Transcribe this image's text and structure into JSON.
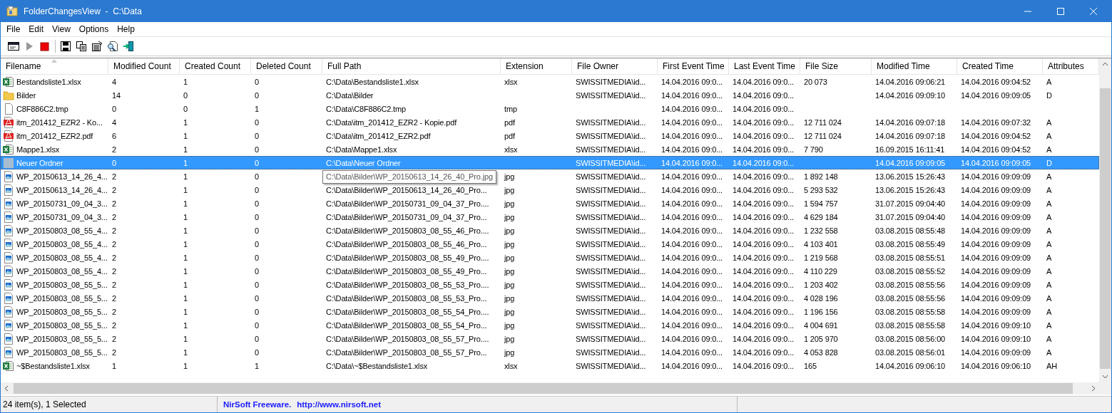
{
  "window": {
    "title": "FolderChangesView  -  C:\\Data"
  },
  "menu": [
    "File",
    "Edit",
    "View",
    "Options",
    "Help"
  ],
  "columns": [
    {
      "label": "Filename",
      "sorted": true
    },
    {
      "label": "Modified Count",
      "sorted": false
    },
    {
      "label": "Created Count",
      "sorted": false
    },
    {
      "label": "Deleted Count",
      "sorted": false
    },
    {
      "label": "Full Path",
      "sorted": false
    },
    {
      "label": "Extension",
      "sorted": false
    },
    {
      "label": "File Owner",
      "sorted": false
    },
    {
      "label": "First Event Time",
      "sorted": false
    },
    {
      "label": "Last Event Time",
      "sorted": false
    },
    {
      "label": "File Size",
      "sorted": false
    },
    {
      "label": "Modified Time",
      "sorted": false
    },
    {
      "label": "Created Time",
      "sorted": false
    },
    {
      "label": "Attributes",
      "sorted": false
    }
  ],
  "rows": [
    {
      "kind": "excel",
      "selected": false,
      "filename": "Bestandsliste1.xlsx",
      "modified_count": "4",
      "created_count": "1",
      "deleted_count": "0",
      "full_path": "C:\\Data\\Bestandsliste1.xlsx",
      "extension": "xlsx",
      "file_owner": "SWISSITMEDIA\\id...",
      "first_event_time": "14.04.2016 09:0...",
      "last_event_time": "14.04.2016 09:0...",
      "file_size": "20 073",
      "modified_time": "14.04.2016 09:06:21",
      "created_time": "14.04.2016 09:04:52",
      "attributes": "A"
    },
    {
      "kind": "folder",
      "selected": false,
      "filename": "Bilder",
      "modified_count": "14",
      "created_count": "0",
      "deleted_count": "0",
      "full_path": "C:\\Data\\Bilder",
      "file_owner": "SWISSITMEDIA\\id...",
      "first_event_time": "14.04.2016 09:0...",
      "last_event_time": "14.04.2016 09:0...",
      "modified_time": "14.04.2016 09:09:10",
      "created_time": "14.04.2016 09:09:05",
      "attributes": "D"
    },
    {
      "kind": "file",
      "selected": false,
      "filename": "C8F886C2.tmp",
      "modified_count": "0",
      "created_count": "0",
      "deleted_count": "1",
      "full_path": "C:\\Data\\C8F886C2.tmp",
      "extension": "tmp",
      "first_event_time": "14.04.2016 09:0...",
      "last_event_time": "14.04.2016 09:0..."
    },
    {
      "kind": "pdf",
      "selected": false,
      "filename": "itm_201412_EZR2 - Ko...",
      "modified_count": "4",
      "created_count": "1",
      "deleted_count": "0",
      "full_path": "C:\\Data\\itm_201412_EZR2 - Kopie.pdf",
      "extension": "pdf",
      "file_owner": "SWISSITMEDIA\\id...",
      "first_event_time": "14.04.2016 09:0...",
      "last_event_time": "14.04.2016 09:0...",
      "file_size": "12 711 024",
      "modified_time": "14.04.2016 09:07:18",
      "created_time": "14.04.2016 09:07:32",
      "attributes": "A"
    },
    {
      "kind": "pdf",
      "selected": false,
      "filename": "itm_201412_EZR2.pdf",
      "modified_count": "6",
      "created_count": "1",
      "deleted_count": "0",
      "full_path": "C:\\Data\\itm_201412_EZR2.pdf",
      "extension": "pdf",
      "file_owner": "SWISSITMEDIA\\id...",
      "first_event_time": "14.04.2016 09:0...",
      "last_event_time": "14.04.2016 09:0...",
      "file_size": "12 711 024",
      "modified_time": "14.04.2016 09:07:18",
      "created_time": "14.04.2016 09:04:52",
      "attributes": "A"
    },
    {
      "kind": "excel",
      "selected": false,
      "filename": "Mappe1.xlsx",
      "modified_count": "2",
      "created_count": "1",
      "deleted_count": "0",
      "full_path": "C:\\Data\\Mappe1.xlsx",
      "extension": "xlsx",
      "file_owner": "SWISSITMEDIA\\id...",
      "first_event_time": "14.04.2016 09:0...",
      "last_event_time": "14.04.2016 09:0...",
      "file_size": "7 790",
      "modified_time": "16.09.2015 16:11:41",
      "created_time": "14.04.2016 09:04:52",
      "attributes": "A"
    },
    {
      "kind": "new-folder",
      "selected": true,
      "filename": "Neuer Ordner",
      "modified_count": "0",
      "created_count": "1",
      "deleted_count": "0",
      "full_path": "C:\\Data\\Neuer Ordner",
      "file_owner": "SWISSITMEDIA\\id...",
      "first_event_time": "14.04.2016 09:0...",
      "last_event_time": "14.04.2016 09:0...",
      "modified_time": "14.04.2016 09:09:05",
      "created_time": "14.04.2016 09:09:05",
      "attributes": "D"
    },
    {
      "kind": "image",
      "selected": false,
      "tooltip": "C:\\Data\\Bilder\\WP_20150613_14_26_40_Pro.jpg",
      "filename": "WP_20150613_14_26_4...",
      "modified_count": "2",
      "created_count": "1",
      "deleted_count": "0",
      "extension": "jpg",
      "file_owner": "SWISSITMEDIA\\id...",
      "first_event_time": "14.04.2016 09:0...",
      "last_event_time": "14.04.2016 09:0...",
      "file_size": "1 892 148",
      "modified_time": "13.06.2015 15:26:43",
      "created_time": "14.04.2016 09:09:09",
      "attributes": "A"
    },
    {
      "kind": "image",
      "selected": false,
      "filename": "WP_20150613_14_26_4...",
      "modified_count": "2",
      "created_count": "1",
      "deleted_count": "0",
      "full_path": "C:\\Data\\Bilder\\WP_20150613_14_26_40_Pro...",
      "extension": "jpg",
      "file_owner": "SWISSITMEDIA\\id...",
      "first_event_time": "14.04.2016 09:0...",
      "last_event_time": "14.04.2016 09:0...",
      "file_size": "5 293 532",
      "modified_time": "13.06.2015 15:26:43",
      "created_time": "14.04.2016 09:09:09",
      "attributes": "A"
    },
    {
      "kind": "image",
      "selected": false,
      "filename": "WP_20150731_09_04_3...",
      "modified_count": "2",
      "created_count": "1",
      "deleted_count": "0",
      "full_path": "C:\\Data\\Bilder\\WP_20150731_09_04_37_Pro....",
      "extension": "jpg",
      "file_owner": "SWISSITMEDIA\\id...",
      "first_event_time": "14.04.2016 09:0...",
      "last_event_time": "14.04.2016 09:0...",
      "file_size": "1 594 757",
      "modified_time": "31.07.2015 09:04:40",
      "created_time": "14.04.2016 09:09:09",
      "attributes": "A"
    },
    {
      "kind": "image",
      "selected": false,
      "filename": "WP_20150731_09_04_3...",
      "modified_count": "2",
      "created_count": "1",
      "deleted_count": "0",
      "full_path": "C:\\Data\\Bilder\\WP_20150731_09_04_37_Pro...",
      "extension": "jpg",
      "file_owner": "SWISSITMEDIA\\id...",
      "first_event_time": "14.04.2016 09:0...",
      "last_event_time": "14.04.2016 09:0...",
      "file_size": "4 629 184",
      "modified_time": "31.07.2015 09:04:40",
      "created_time": "14.04.2016 09:09:09",
      "attributes": "A"
    },
    {
      "kind": "image",
      "selected": false,
      "filename": "WP_20150803_08_55_4...",
      "modified_count": "2",
      "created_count": "1",
      "deleted_count": "0",
      "full_path": "C:\\Data\\Bilder\\WP_20150803_08_55_46_Pro....",
      "extension": "jpg",
      "file_owner": "SWISSITMEDIA\\id...",
      "first_event_time": "14.04.2016 09:0...",
      "last_event_time": "14.04.2016 09:0...",
      "file_size": "1 232 558",
      "modified_time": "03.08.2015 08:55:48",
      "created_time": "14.04.2016 09:09:09",
      "attributes": "A"
    },
    {
      "kind": "image",
      "selected": false,
      "filename": "WP_20150803_08_55_4...",
      "modified_count": "2",
      "created_count": "1",
      "deleted_count": "0",
      "full_path": "C:\\Data\\Bilder\\WP_20150803_08_55_46_Pro...",
      "extension": "jpg",
      "file_owner": "SWISSITMEDIA\\id...",
      "first_event_time": "14.04.2016 09:0...",
      "last_event_time": "14.04.2016 09:0...",
      "file_size": "4 103 401",
      "modified_time": "03.08.2015 08:55:49",
      "created_time": "14.04.2016 09:09:09",
      "attributes": "A"
    },
    {
      "kind": "image",
      "selected": false,
      "filename": "WP_20150803_08_55_4...",
      "modified_count": "2",
      "created_count": "1",
      "deleted_count": "0",
      "full_path": "C:\\Data\\Bilder\\WP_20150803_08_55_49_Pro....",
      "extension": "jpg",
      "file_owner": "SWISSITMEDIA\\id...",
      "first_event_time": "14.04.2016 09:0...",
      "last_event_time": "14.04.2016 09:0...",
      "file_size": "1 219 568",
      "modified_time": "03.08.2015 08:55:51",
      "created_time": "14.04.2016 09:09:09",
      "attributes": "A"
    },
    {
      "kind": "image",
      "selected": false,
      "filename": "WP_20150803_08_55_4...",
      "modified_count": "2",
      "created_count": "1",
      "deleted_count": "0",
      "full_path": "C:\\Data\\Bilder\\WP_20150803_08_55_49_Pro...",
      "extension": "jpg",
      "file_owner": "SWISSITMEDIA\\id...",
      "first_event_time": "14.04.2016 09:0...",
      "last_event_time": "14.04.2016 09:0...",
      "file_size": "4 110 229",
      "modified_time": "03.08.2015 08:55:52",
      "created_time": "14.04.2016 09:09:09",
      "attributes": "A"
    },
    {
      "kind": "image",
      "selected": false,
      "filename": "WP_20150803_08_55_5...",
      "modified_count": "2",
      "created_count": "1",
      "deleted_count": "0",
      "full_path": "C:\\Data\\Bilder\\WP_20150803_08_55_53_Pro....",
      "extension": "jpg",
      "file_owner": "SWISSITMEDIA\\id...",
      "first_event_time": "14.04.2016 09:0...",
      "last_event_time": "14.04.2016 09:0...",
      "file_size": "1 203 402",
      "modified_time": "03.08.2015 08:55:56",
      "created_time": "14.04.2016 09:09:09",
      "attributes": "A"
    },
    {
      "kind": "image",
      "selected": false,
      "filename": "WP_20150803_08_55_5...",
      "modified_count": "2",
      "created_count": "1",
      "deleted_count": "0",
      "full_path": "C:\\Data\\Bilder\\WP_20150803_08_55_53_Pro...",
      "extension": "jpg",
      "file_owner": "SWISSITMEDIA\\id...",
      "first_event_time": "14.04.2016 09:0...",
      "last_event_time": "14.04.2016 09:0...",
      "file_size": "4 028 196",
      "modified_time": "03.08.2015 08:55:56",
      "created_time": "14.04.2016 09:09:09",
      "attributes": "A"
    },
    {
      "kind": "image",
      "selected": false,
      "filename": "WP_20150803_08_55_5...",
      "modified_count": "2",
      "created_count": "1",
      "deleted_count": "0",
      "full_path": "C:\\Data\\Bilder\\WP_20150803_08_55_54_Pro....",
      "extension": "jpg",
      "file_owner": "SWISSITMEDIA\\id...",
      "first_event_time": "14.04.2016 09:0...",
      "last_event_time": "14.04.2016 09:0...",
      "file_size": "1 196 156",
      "modified_time": "03.08.2015 08:55:58",
      "created_time": "14.04.2016 09:09:09",
      "attributes": "A"
    },
    {
      "kind": "image",
      "selected": false,
      "filename": "WP_20150803_08_55_5...",
      "modified_count": "2",
      "created_count": "1",
      "deleted_count": "0",
      "full_path": "C:\\Data\\Bilder\\WP_20150803_08_55_54_Pro...",
      "extension": "jpg",
      "file_owner": "SWISSITMEDIA\\id...",
      "first_event_time": "14.04.2016 09:0...",
      "last_event_time": "14.04.2016 09:0...",
      "file_size": "4 004 691",
      "modified_time": "03.08.2015 08:55:58",
      "created_time": "14.04.2016 09:09:10",
      "attributes": "A"
    },
    {
      "kind": "image",
      "selected": false,
      "filename": "WP_20150803_08_55_5...",
      "modified_count": "2",
      "created_count": "1",
      "deleted_count": "0",
      "full_path": "C:\\Data\\Bilder\\WP_20150803_08_55_57_Pro....",
      "extension": "jpg",
      "file_owner": "SWISSITMEDIA\\id...",
      "first_event_time": "14.04.2016 09:0...",
      "last_event_time": "14.04.2016 09:0...",
      "file_size": "1 205 970",
      "modified_time": "03.08.2015 08:56:00",
      "created_time": "14.04.2016 09:09:10",
      "attributes": "A"
    },
    {
      "kind": "image",
      "selected": false,
      "filename": "WP_20150803_08_55_5...",
      "modified_count": "2",
      "created_count": "1",
      "deleted_count": "0",
      "full_path": "C:\\Data\\Bilder\\WP_20150803_08_55_57_Pro...",
      "extension": "jpg",
      "file_owner": "SWISSITMEDIA\\id...",
      "first_event_time": "14.04.2016 09:0...",
      "last_event_time": "14.04.2016 09:0...",
      "file_size": "4 053 828",
      "modified_time": "03.08.2015 08:56:01",
      "created_time": "14.04.2016 09:09:09",
      "attributes": "A"
    },
    {
      "kind": "excel",
      "selected": false,
      "filename": "~$Bestandsliste1.xlsx",
      "modified_count": "1",
      "created_count": "1",
      "deleted_count": "1",
      "full_path": "C:\\Data\\~$Bestandsliste1.xlsx",
      "extension": "xlsx",
      "file_owner": "SWISSITMEDIA\\id...",
      "first_event_time": "14.04.2016 09:0...",
      "last_event_time": "14.04.2016 09:0...",
      "file_size": "165",
      "modified_time": "14.04.2016 09:06:10",
      "created_time": "14.04.2016 09:06:10",
      "attributes": "AH"
    }
  ],
  "status_bar": {
    "count": "24 item(s), 1 Selected",
    "credit": "NirSoft Freeware.",
    "link": "http://www.nirsoft.net"
  }
}
